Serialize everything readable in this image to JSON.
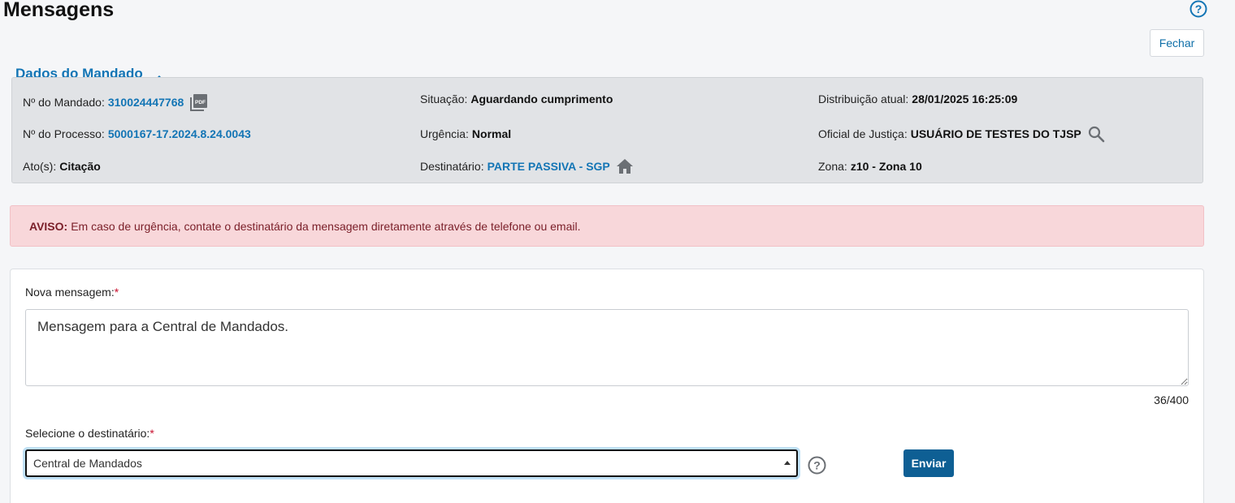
{
  "header": {
    "title": "Mensagens",
    "close_label": "Fechar"
  },
  "mandado": {
    "section_title": "Dados do Mandado",
    "numero_label": "Nº do Mandado:",
    "numero_value": "310024447768",
    "situacao_label": "Situação:",
    "situacao_value": "Aguardando cumprimento",
    "distribuicao_label": "Distribuição atual:",
    "distribuicao_value": "28/01/2025 16:25:09",
    "processo_label": "Nº do Processo:",
    "processo_value": "5000167-17.2024.8.24.0043",
    "urgencia_label": "Urgência:",
    "urgencia_value": "Normal",
    "oficial_label": "Oficial de Justiça:",
    "oficial_value": "USUÁRIO DE TESTES DO TJSP",
    "atos_label": "Ato(s):",
    "atos_value": "Citação",
    "destinatario_label": "Destinatário:",
    "destinatario_value": "PARTE PASSIVA - SGP",
    "zona_label": "Zona:",
    "zona_value": "z10 - Zona 10"
  },
  "alert": {
    "strong": "AVISO:",
    "text": "Em caso de urgência, contate o destinatário da mensagem diretamente através de telefone ou email."
  },
  "form": {
    "message_label": "Nova mensagem:",
    "required_mark": "*",
    "message_value": "Mensagem para a Central de Mandados.",
    "counter": "36/400",
    "recipient_label": "Selecione o destinatário:",
    "recipient_value": "Central de Mandados",
    "send_label": "Enviar"
  },
  "colors": {
    "accent": "#1375b5",
    "primary_button": "#0e5f94",
    "alert_bg": "#f8d7da",
    "alert_text": "#7a1e28"
  },
  "icons": {
    "help": "help-circle-icon",
    "pdf": "pdf-icon",
    "search": "search-icon",
    "home": "home-icon",
    "caret": "caret-up-icon"
  }
}
